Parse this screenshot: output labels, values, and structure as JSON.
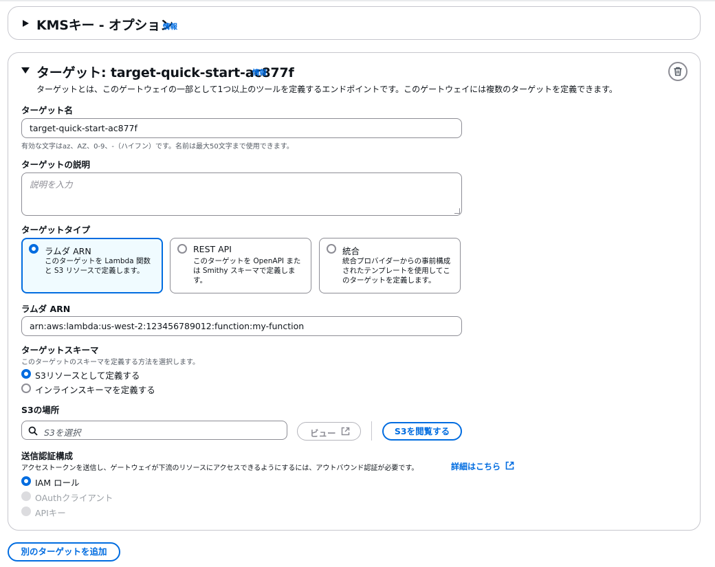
{
  "kms": {
    "title": "KMSキー - オプション",
    "info": "情報"
  },
  "target": {
    "title": "ターゲット: target-quick-start-ac877f",
    "info": "情報",
    "description": "ターゲットとは、このゲートウェイの一部として1つ以上のツールを定義するエンドポイントです。このゲートウェイには複数のターゲットを定義できます。",
    "name": {
      "label": "ターゲット名",
      "value": "target-quick-start-ac877f",
      "hint": "有効な文字はaz、AZ、0-9、-（ハイフン）です。名前は最大50文字まで使用できます。"
    },
    "target_description": {
      "label": "ターゲットの説明",
      "placeholder": "説明を入力"
    },
    "type": {
      "label": "ターゲットタイプ",
      "options": [
        {
          "title": "ラムダ ARN",
          "desc": "このターゲットを Lambda 関数と S3 リソースで定義します。",
          "selected": true
        },
        {
          "title": "REST API",
          "desc": "このターゲットを OpenAPI または Smithy スキーマで定義します。",
          "selected": false
        },
        {
          "title": "統合",
          "desc": "統合プロバイダーからの事前構成されたテンプレートを使用してこのターゲットを定義します。",
          "selected": false
        }
      ]
    },
    "lambda_arn": {
      "label": "ラムダ ARN",
      "value": "arn:aws:lambda:us-west-2:123456789012:function:my-function"
    },
    "schema": {
      "label": "ターゲットスキーマ",
      "hint": "このターゲットのスキーマを定義する方法を選択します。",
      "options": [
        {
          "label": "S3リソースとして定義する",
          "selected": true
        },
        {
          "label": "インラインスキーマを定義する",
          "selected": false
        }
      ]
    },
    "s3": {
      "label": "S3の場所",
      "placeholder": "S3を選択",
      "view_button": "ビュー",
      "browse_button": "S3を閲覧する"
    },
    "auth": {
      "label": "送信認証構成",
      "hint": "アクセストークンを送信し、ゲートウェイが下流のリソースにアクセスできるようにするには、アウトバウンド認証が必要です。",
      "learn_more": "詳細はこちら",
      "options": [
        {
          "label": "IAM ロール",
          "selected": true,
          "disabled": false
        },
        {
          "label": "OAuthクライアント",
          "selected": false,
          "disabled": true
        },
        {
          "label": "APIキー",
          "selected": false,
          "disabled": true
        }
      ]
    }
  },
  "add_target_button": "別のターゲットを追加",
  "colors": {
    "accent": "#006ce0",
    "border": "#8c8c94",
    "text": "#0f141a",
    "selected_tile_bg": "#f0fbff"
  }
}
